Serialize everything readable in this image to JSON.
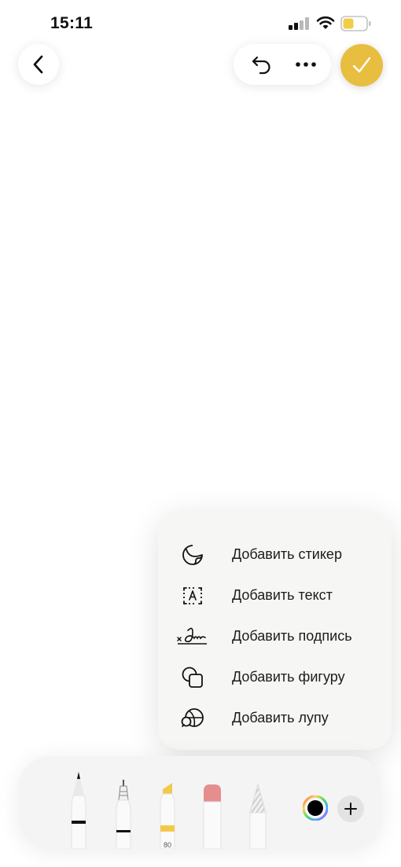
{
  "status_bar": {
    "time": "15:11",
    "battery_color": "#f2cd48"
  },
  "top_bar": {
    "back_icon": "chevron-left-icon",
    "undo_icon": "undo-icon",
    "more_icon": "ellipsis-icon",
    "done_icon": "checkmark-icon",
    "done_color": "#e7be3f"
  },
  "menu": {
    "items": [
      {
        "label": "Добавить стикер",
        "icon": "sticker-icon"
      },
      {
        "label": "Добавить текст",
        "icon": "text-box-icon"
      },
      {
        "label": "Добавить подпись",
        "icon": "signature-icon"
      },
      {
        "label": "Добавить фигуру",
        "icon": "shapes-icon"
      },
      {
        "label": "Добавить лупу",
        "icon": "magnifier-icon"
      }
    ]
  },
  "toolbar": {
    "tools": [
      {
        "name": "pen",
        "icon": "pen-icon"
      },
      {
        "name": "fineliner",
        "icon": "fineliner-icon"
      },
      {
        "name": "marker",
        "icon": "marker-icon",
        "opacity_label": "80",
        "color": "#f2c94c"
      },
      {
        "name": "eraser",
        "icon": "eraser-icon",
        "color": "#e58e8e"
      },
      {
        "name": "pencil",
        "icon": "pencil-icon"
      }
    ],
    "color_icon": "color-picker-icon",
    "selected_color": "#000000",
    "add_icon": "plus-icon"
  }
}
